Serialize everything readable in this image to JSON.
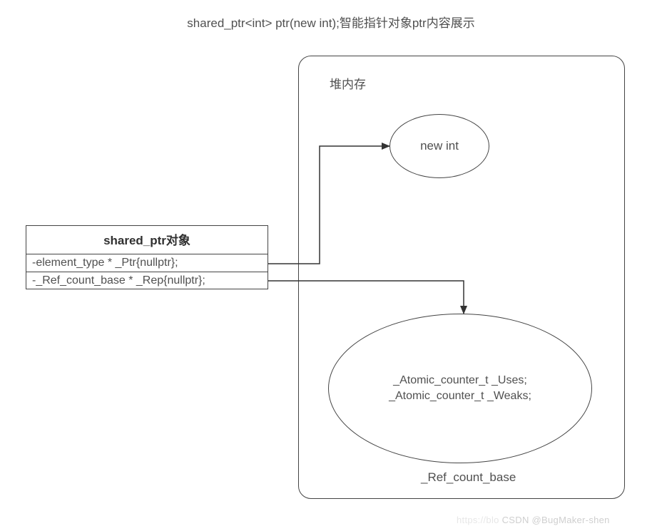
{
  "title": "shared_ptr<int> ptr(new int);智能指针对象ptr内容展示",
  "heap": {
    "label": "堆内存",
    "new_int": "new int",
    "ref_count_base_label": "_Ref_count_base",
    "ref_count_base_body_line1": "_Atomic_counter_t _Uses;",
    "ref_count_base_body_line2": "_Atomic_counter_t _Weaks;"
  },
  "shared_ptr": {
    "title": "shared_ptr对象",
    "field1": "-element_type * _Ptr{nullptr};",
    "field2": "-_Ref_count_base * _Rep{nullptr};"
  },
  "watermark": {
    "ghost": "https://blo",
    "text": "CSDN @BugMaker-shen"
  }
}
